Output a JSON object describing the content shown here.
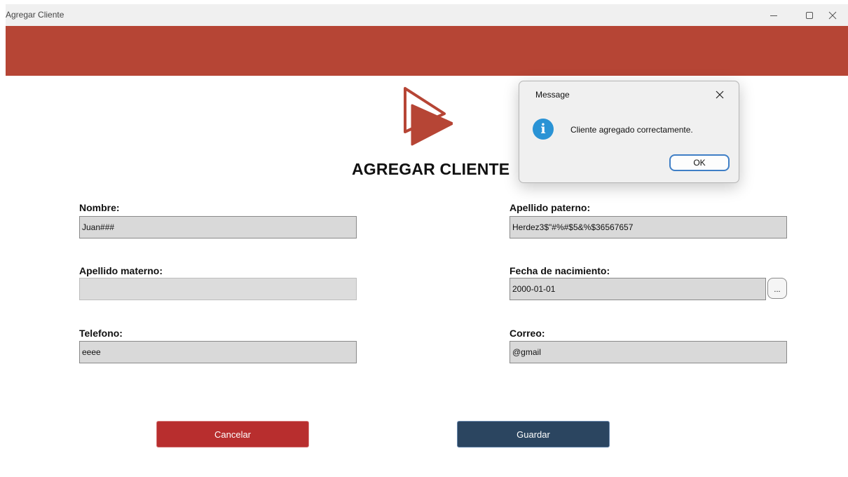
{
  "window": {
    "title": "Agregar Cliente"
  },
  "colors": {
    "banner": "#b64535",
    "cancel_button": "#b82e2e",
    "save_button": "#2b4560",
    "info_icon": "#2a93d5"
  },
  "form": {
    "title": "AGREGAR CLIENTE",
    "fields": {
      "nombre": {
        "label": "Nombre:",
        "value": "Juan###"
      },
      "apellido_paterno": {
        "label": "Apellido paterno:",
        "value": "Herdez3$\"#%#$5&%$36567657"
      },
      "apellido_materno": {
        "label": "Apellido materno:",
        "value": ""
      },
      "fecha_nacimiento": {
        "label": "Fecha de nacimiento:",
        "value": "2000-01-01",
        "picker_label": "..."
      },
      "telefono": {
        "label": "Telefono:",
        "value": "eeee"
      },
      "correo": {
        "label": "Correo:",
        "value": "@gmail"
      }
    },
    "buttons": {
      "cancel_label": "Cancelar",
      "save_label": "Guardar"
    }
  },
  "dialog": {
    "title": "Message",
    "message": "Cliente agregado correctamente.",
    "ok_label": "OK",
    "icon": "info-icon"
  }
}
